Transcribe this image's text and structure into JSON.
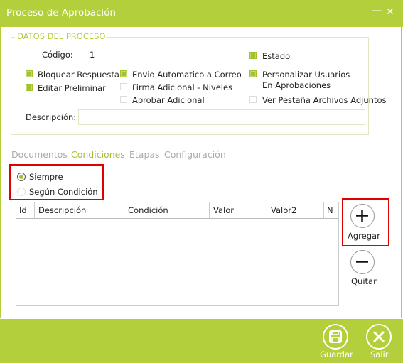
{
  "window": {
    "title": "Proceso de Aprobación",
    "minimize_icon": "minimize-icon",
    "close_icon": "close-icon"
  },
  "group": {
    "legend": "DATOS DEL PROCESO",
    "codigo_label": "Código:",
    "codigo_value": "1",
    "estado": {
      "label": "Estado",
      "checked": true
    },
    "bloquear_respuesta": {
      "label": "Bloquear Respuesta",
      "checked": true
    },
    "editar_preliminar": {
      "label": "Editar Preliminar",
      "checked": true
    },
    "envio_automatico": {
      "label": "Envio Automatico a Correo",
      "checked": true
    },
    "firma_adicional": {
      "label": "Firma Adicional - Niveles",
      "checked": false
    },
    "aprobar_adicional": {
      "label": "Aprobar Adicional",
      "checked": false
    },
    "personalizar_usuarios": {
      "label_line1": "Personalizar Usuarios",
      "label_line2": "En Aprobaciones",
      "checked": true
    },
    "ver_pestana": {
      "label": "Ver Pestaña Archivos Adjuntos",
      "checked": false
    },
    "descripcion_label": "Descripción:",
    "descripcion_value": ""
  },
  "tabs": [
    {
      "label": "Documentos",
      "active": false
    },
    {
      "label": "Condiciones",
      "active": true
    },
    {
      "label": "Etapas",
      "active": false
    },
    {
      "label": "Configuración",
      "active": false
    }
  ],
  "radios": [
    {
      "label": "Siempre",
      "selected": true
    },
    {
      "label": "Según Condición",
      "selected": false
    }
  ],
  "grid": {
    "columns": [
      "Id",
      "Descripción",
      "Condición",
      "Valor",
      "Valor2",
      "N"
    ],
    "rows": []
  },
  "side_buttons": {
    "agregar": {
      "label": "Agregar",
      "icon": "plus-icon"
    },
    "quitar": {
      "label": "Quitar",
      "icon": "minus-icon"
    }
  },
  "footer": {
    "guardar": {
      "label": "Guardar",
      "icon": "save-icon"
    },
    "salir": {
      "label": "Salir",
      "icon": "close-circle-icon"
    }
  },
  "colors": {
    "accent": "#b3cf3b",
    "checkbox": "#a4c131",
    "highlight": "#e00000"
  }
}
